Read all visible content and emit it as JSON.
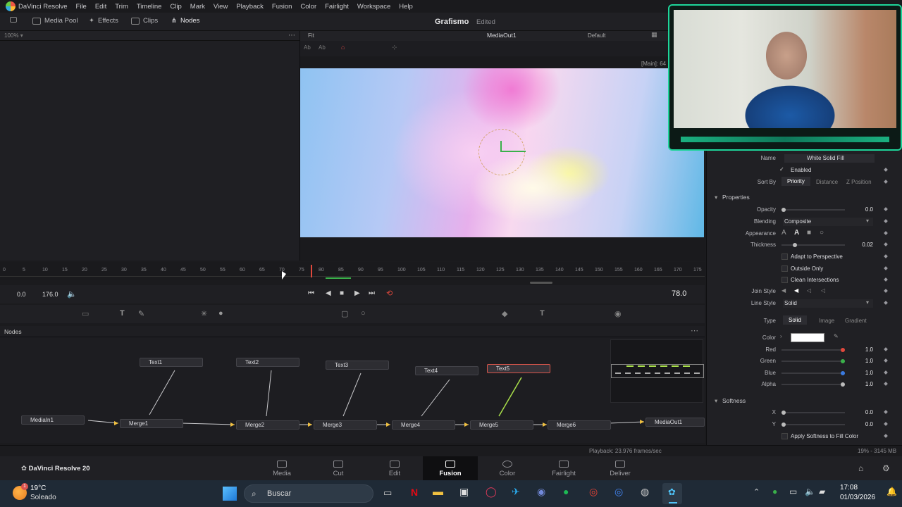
{
  "app": {
    "name": "DaVinci Resolve",
    "menu": [
      "File",
      "Edit",
      "Trim",
      "Timeline",
      "Clip",
      "Mark",
      "View",
      "Playback",
      "Fusion",
      "Color",
      "Fairlight",
      "Workspace",
      "Help"
    ]
  },
  "toolbar": {
    "zoom": "100%",
    "media_pool": "Media Pool",
    "effects": "Effects",
    "clips": "Clips",
    "nodes": "Nodes",
    "project_title": "Grafismo",
    "project_status": "Edited"
  },
  "viewer": {
    "fit": "Fit",
    "name": "MediaOut1",
    "lut": "Default",
    "info": "[Main]: 64"
  },
  "ruler": {
    "ticks": [
      "0",
      "5",
      "10",
      "15",
      "20",
      "25",
      "30",
      "35",
      "40",
      "45",
      "50",
      "55",
      "60",
      "65",
      "70",
      "75",
      "80",
      "85",
      "90",
      "95",
      "100",
      "105",
      "110",
      "115",
      "120",
      "125",
      "130",
      "135",
      "140",
      "145",
      "150",
      "155",
      "160",
      "165",
      "170",
      "175"
    ]
  },
  "transport": {
    "start": "0.0",
    "end": "176.0",
    "current": "78.0"
  },
  "nodes_panel": {
    "title": "Nodes",
    "nodes": [
      "Text1",
      "Text2",
      "Text3",
      "Text4",
      "Text5",
      "MediaIn1",
      "Merge1",
      "Merge2",
      "Merge3",
      "Merge4",
      "Merge5",
      "Merge6",
      "MediaOut1"
    ]
  },
  "inspector": {
    "name_label": "Name",
    "name_value": "White Solid Fill",
    "enabled": "Enabled",
    "sort_by": "Sort By",
    "sort_options": [
      "Priority",
      "Distance",
      "Z Position"
    ],
    "properties": "Properties",
    "opacity_label": "Opacity",
    "opacity_value": "0.0",
    "opacity": 0.0,
    "blending_label": "Blending",
    "blending_value": "Composite",
    "appearance_label": "Appearance",
    "thickness_label": "Thickness",
    "thickness_value": "0.02",
    "thickness": 0.02,
    "adapt": "Adapt to Perspective",
    "outside_only": "Outside Only",
    "clean_intersections": "Clean Intersections",
    "join_style": "Join Style",
    "line_style": "Line Style",
    "line_style_value": "Solid",
    "type_label": "Type",
    "type_options": [
      "Solid",
      "Image",
      "Gradient"
    ],
    "color_label": "Color",
    "color_swatch": "#ffffff",
    "red_label": "Red",
    "red_value": "1.0",
    "green_label": "Green",
    "green_value": "1.0",
    "blue_label": "Blue",
    "blue_value": "1.0",
    "alpha_label": "Alpha",
    "alpha_value": "1.0",
    "softness": "Softness",
    "x_label": "X",
    "x_value": "0.0",
    "y_label": "Y",
    "y_value": "0.0",
    "apply_softness": "Apply Softness to Fill Color"
  },
  "status": {
    "playback": "Playback: 23.976 frames/sec",
    "memory": "19% - 3145 MB"
  },
  "pagebar": {
    "app_label": "DaVinci Resolve 20",
    "pages": [
      "Media",
      "Cut",
      "Edit",
      "Fusion",
      "Color",
      "Fairlight",
      "Deliver"
    ],
    "active": "Fusion"
  },
  "taskbar": {
    "temp": "19°C",
    "weather": "Soleado",
    "weather_badge": "1",
    "search": "Buscar",
    "time": "17:08",
    "date": "01/03/2026"
  },
  "colors": {
    "accent": "#e06a5c",
    "webcam_border": "#1ed59a",
    "selected_node": "#d7554a"
  }
}
